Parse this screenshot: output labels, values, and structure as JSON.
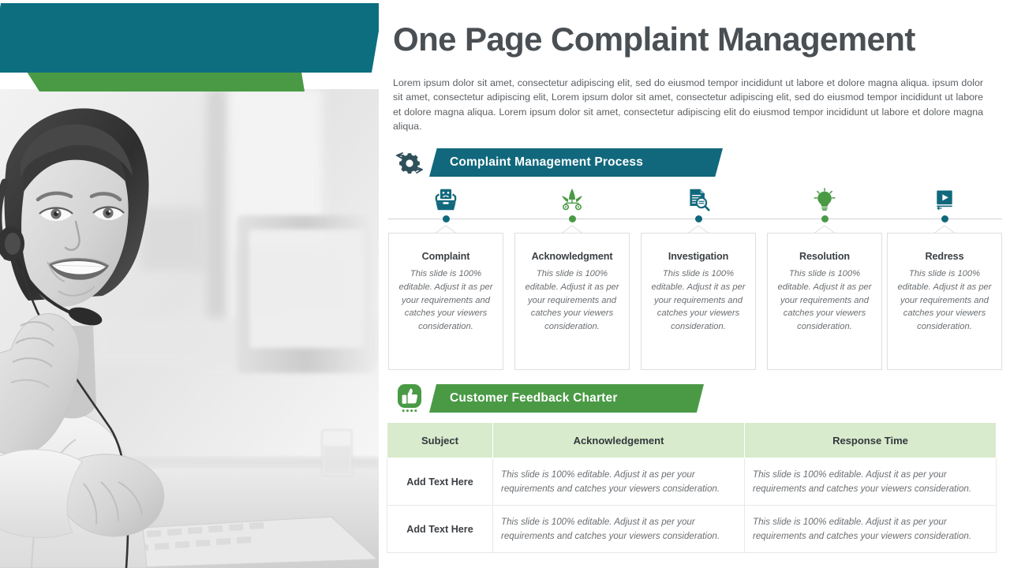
{
  "slide": {
    "title": "One Page Complaint Management",
    "intro": "Lorem ipsum dolor sit amet, consectetur adipiscing elit, sed do eiusmod tempor incididunt ut labore et dolore magna aliqua. ipsum dolor sit amet, consectetur adipiscing elit, Lorem ipsum dolor sit amet, consectetur adipiscing elit, sed do eiusmod tempor incididunt ut labore et dolore magna aliqua. Lorem ipsum dolor sit amet, consectetur adipiscing elit do eiusmod tempor incididunt ut labore et dolore magna aliqua."
  },
  "colors": {
    "teal": "#0d6e80",
    "teal_banner": "#11687c",
    "green": "#4a9a45",
    "table_header": "#d8ebcd",
    "title_gray": "#4a4f54",
    "body_gray": "#6b6f73"
  },
  "process_section": {
    "banner_label": "Complaint Management Process",
    "banner_icon": "gear-arrows-icon",
    "steps": [
      {
        "title": "Complaint",
        "body": "This slide is 100% editable. Adjust it as per your requirements and catches your viewers consideration.",
        "icon": "complaint-box-sad-face-icon",
        "color": "#11687c"
      },
      {
        "title": "Acknowledgment",
        "body": "This slide is 100% editable. Adjust it as per your requirements and catches your viewers consideration.",
        "icon": "network-hierarchy-icon",
        "color": "#4a9a45"
      },
      {
        "title": "Investigation",
        "body": "This slide is 100% editable. Adjust it as per your requirements and catches your viewers consideration.",
        "icon": "document-magnifier-icon",
        "color": "#11687c"
      },
      {
        "title": "Resolution",
        "body": "This slide is 100% editable. Adjust it as per your requirements and catches your viewers consideration.",
        "icon": "lightbulb-icon",
        "color": "#4a9a45"
      },
      {
        "title": "Redress",
        "body": "This slide is 100% editable. Adjust it as per your requirements and catches your viewers consideration.",
        "icon": "play-button-icon",
        "color": "#11687c"
      }
    ]
  },
  "charter_section": {
    "banner_label": "Customer Feedback Charter",
    "banner_icon": "thumbs-up-icon",
    "columns": [
      "Subject",
      "Acknowledgement",
      "Response Time"
    ],
    "rows": [
      {
        "subject": "Add Text Here",
        "acknowledgement": "This slide is 100% editable. Adjust it as per your requirements and catches your viewers consideration.",
        "response_time": "This slide is 100% editable. Adjust it as per your requirements and catches your viewers consideration."
      },
      {
        "subject": "Add Text Here",
        "acknowledgement": "This slide is 100% editable. Adjust it as per your requirements and catches your viewers consideration.",
        "response_time": "This slide is 100% editable. Adjust it as per your requirements and catches your viewers consideration."
      }
    ]
  },
  "decoration": {
    "photo_alt": "call-center-agent-with-headset-grayscale-photo"
  }
}
